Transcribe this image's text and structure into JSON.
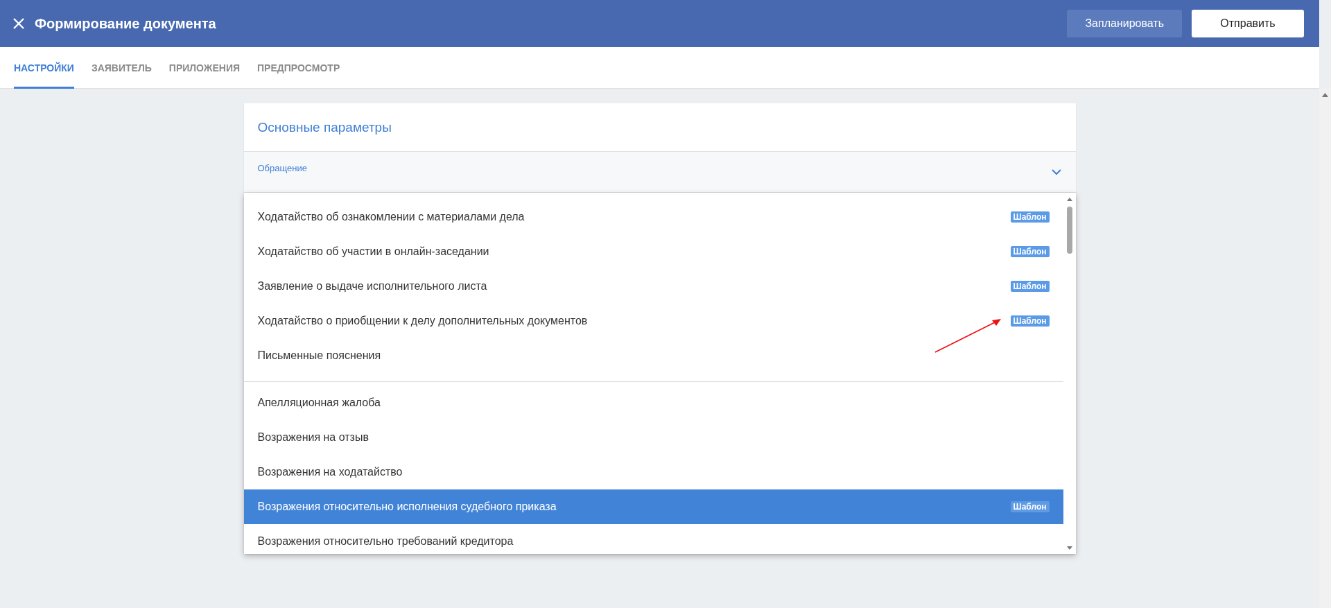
{
  "header": {
    "title": "Формирование документа",
    "buttons": [
      {
        "label": "Запланировать",
        "kind": "secondary"
      },
      {
        "label": "Отправить",
        "kind": "primary"
      }
    ]
  },
  "tabs": [
    {
      "label": "НАСТРОЙКИ",
      "selected": true
    },
    {
      "label": "ЗАЯВИТЕЛЬ",
      "selected": false
    },
    {
      "label": "ПРИЛОЖЕНИЯ",
      "selected": false
    },
    {
      "label": "ПРЕДПРОСМОТР",
      "selected": false
    }
  ],
  "section": {
    "title": "Основные параметры",
    "field": {
      "label": "Обращение",
      "expanded": true
    }
  },
  "dropdown": {
    "groups": [
      {
        "items": [
          {
            "label": "Ходатайство об ознакомлении с материалами дела",
            "badge": "Шаблон",
            "selected": false
          },
          {
            "label": "Ходатайство об участии в онлайн-заседании",
            "badge": "Шаблон",
            "selected": false
          },
          {
            "label": "Заявление о выдаче исполнительного листа",
            "badge": "Шаблон",
            "selected": false
          },
          {
            "label": "Ходатайство о приобщении к делу дополнительных документов",
            "badge": "Шаблон",
            "selected": false,
            "annotated": true
          },
          {
            "label": "Письменные пояснения",
            "selected": false
          }
        ]
      },
      {
        "items": [
          {
            "label": "Апелляционная жалоба",
            "selected": false
          },
          {
            "label": "Возражения на отзыв",
            "selected": false
          },
          {
            "label": "Возражения на ходатайство",
            "selected": false
          },
          {
            "label": "Возражения относительно исполнения судебного приказа",
            "badge": "Шаблон",
            "selected": true
          },
          {
            "label": "Возражения относительно требований кредитора",
            "selected": false
          }
        ]
      }
    ]
  }
}
